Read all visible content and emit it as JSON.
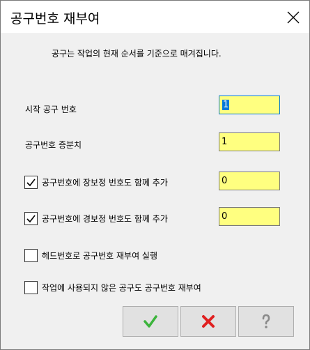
{
  "window": {
    "title": "공구번호 재부여"
  },
  "description": "공구는 작업의 현재 순서를 기준으로 매겨집니다.",
  "fields": {
    "start_number_label": "시작 공구 번호",
    "start_number_value": "1",
    "increment_label": "공구번호 증분치",
    "increment_value": "1"
  },
  "options": {
    "add_long_comp": {
      "label": "공구번호에 장보정 번호도 함께 추가",
      "checked": true,
      "value": "0"
    },
    "add_diam_comp": {
      "label": "공구번호에 경보정 번호도 함께 추가",
      "checked": true,
      "value": "0"
    },
    "renumber_by_head": {
      "label": "헤드번호로 공구번호 재부여 실행",
      "checked": false
    },
    "renumber_unused": {
      "label": "작업에 사용되지 않은 공구도 공구번호 재부여",
      "checked": false
    }
  },
  "buttons": {
    "ok_icon": "check-icon",
    "cancel_icon": "x-icon",
    "help_icon": "question-icon"
  },
  "colors": {
    "input_bg": "#ffff80",
    "ok_green": "#3cb43c",
    "cancel_red": "#e02020",
    "help_gray": "#8a8a8a",
    "focus_blue": "#0078d7"
  }
}
